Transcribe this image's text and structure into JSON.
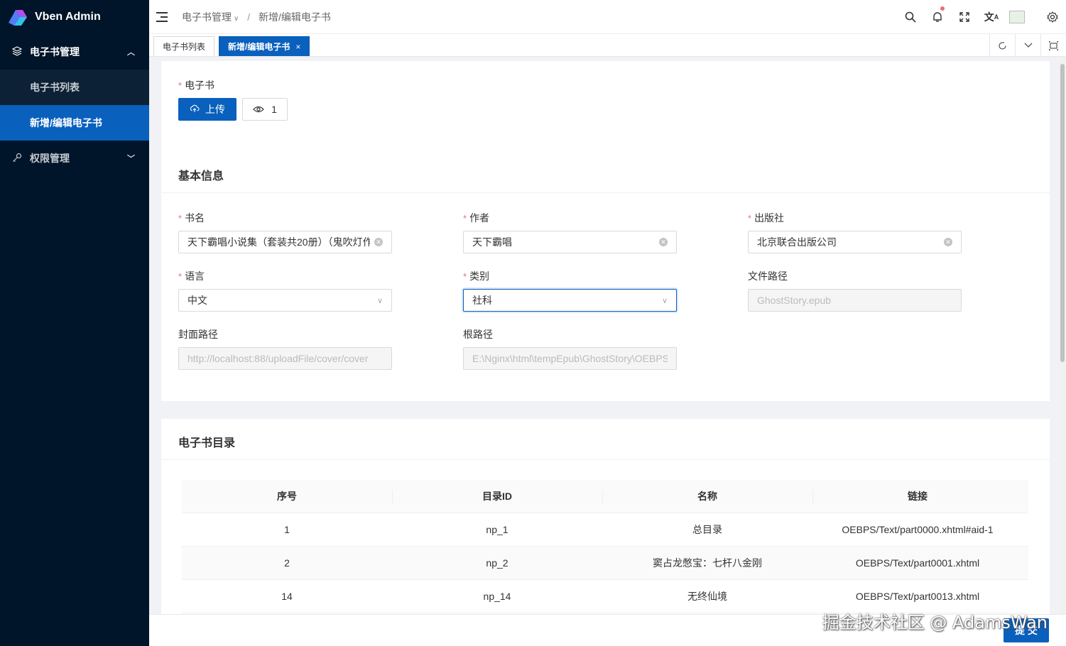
{
  "app": {
    "title": "Vben Admin"
  },
  "sidebar": {
    "group1": {
      "label": "电子书管理"
    },
    "items": [
      {
        "label": "电子书列表"
      },
      {
        "label": "新增/编辑电子书"
      }
    ],
    "group2": {
      "label": "权限管理"
    }
  },
  "header": {
    "breadcrumb": [
      "电子书管理",
      "新增/编辑电子书"
    ]
  },
  "tabs": [
    {
      "label": "电子书列表"
    },
    {
      "label": "新增/编辑电子书",
      "close": "×"
    }
  ],
  "upload": {
    "label": "电子书",
    "upload_button": "上传",
    "view_count": "1"
  },
  "basic_info": {
    "title": "基本信息",
    "fields": {
      "title": {
        "label": "书名",
        "value": "天下霸唱小说集（套装共20册）（鬼吹灯作"
      },
      "author": {
        "label": "作者",
        "value": "天下霸唱"
      },
      "publisher": {
        "label": "出版社",
        "value": "北京联合出版公司"
      },
      "language": {
        "label": "语言",
        "value": "中文"
      },
      "category": {
        "label": "类别",
        "value": "社科"
      },
      "file_path": {
        "label": "文件路径",
        "value": "GhostStory.epub"
      },
      "cover_path": {
        "label": "封面路径",
        "value": "http://localhost:88/uploadFile/cover/cover"
      },
      "root_path": {
        "label": "根路径",
        "value": "E:\\Nginx\\html\\tempEpub\\GhostStory\\OEBPS"
      }
    }
  },
  "toc": {
    "title": "电子书目录",
    "columns": [
      "序号",
      "目录ID",
      "名称",
      "链接"
    ],
    "rows": [
      [
        "1",
        "np_1",
        "总目录",
        "OEBPS/Text/part0000.xhtml#aid-1"
      ],
      [
        "2",
        "np_2",
        "窦占龙憋宝：七杆八金刚",
        "OEBPS/Text/part0001.xhtml"
      ],
      [
        "14",
        "np_14",
        "无终仙境",
        "OEBPS/Text/part0013.xhtml"
      ]
    ]
  },
  "footer": {
    "submit": "提 交"
  },
  "watermark": "掘金技术社区 @ AdamsWan",
  "colors": {
    "primary": "#0960bd",
    "sidebar_bg": "#001529",
    "required": "#ed6f6f"
  }
}
